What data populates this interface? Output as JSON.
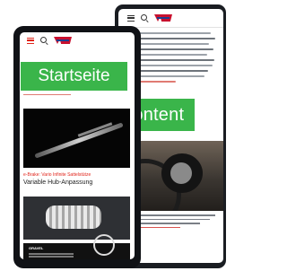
{
  "back_phone": {
    "banner_label": "Content",
    "icons": [
      "hamburger-icon",
      "search-icon",
      "brand-logo"
    ]
  },
  "front_phone": {
    "banner_label": "Startseite",
    "icons": [
      "hamburger-icon",
      "search-icon",
      "brand-logo"
    ],
    "article": {
      "tag": "e-Brake: Vario Infinite Sattelstütze",
      "title": "Variable Hub-Anpassung"
    },
    "ad": {
      "brand": "GRAVEL"
    }
  },
  "colors": {
    "accent_green": "#3ab54a",
    "accent_red": "#e1261c",
    "phone_frame": "#101216"
  }
}
